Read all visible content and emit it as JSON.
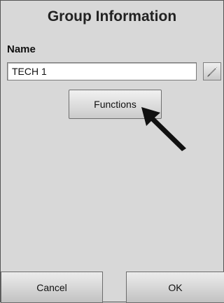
{
  "dialog": {
    "title": "Group Information"
  },
  "name_field": {
    "label": "Name",
    "value": "TECH 1"
  },
  "buttons": {
    "functions_label": "Functions",
    "cancel_label": "Cancel",
    "ok_label": "OK"
  },
  "icons": {
    "edit": "pencil-icon",
    "pointer": "cursor-arrow-icon"
  },
  "colors": {
    "background": "#d8d8d8",
    "input_background": "#ffffff",
    "button_top": "#f1f1f1",
    "button_bottom": "#c9c9c9",
    "border": "#6f6f6f",
    "text": "#111111"
  }
}
